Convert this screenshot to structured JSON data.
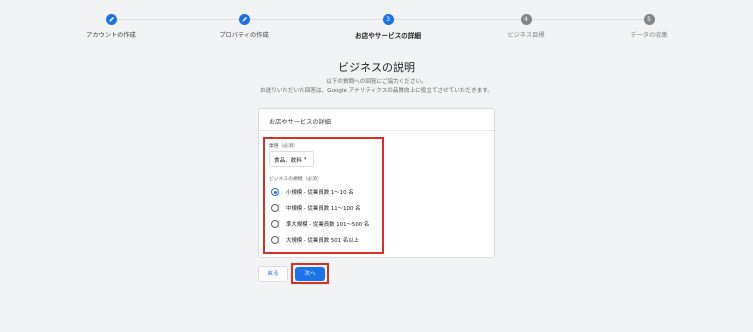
{
  "stepper": {
    "steps": [
      {
        "label": "アカウントの作成",
        "marker": "",
        "icon": "pencil-icon",
        "state": "done"
      },
      {
        "label": "プロパティの作成",
        "marker": "",
        "icon": "pencil-icon",
        "state": "done"
      },
      {
        "label": "お店やサービスの詳細",
        "marker": "3",
        "state": "active"
      },
      {
        "label": "ビジネス目標",
        "marker": "4",
        "state": "todo"
      },
      {
        "label": "データの収集",
        "marker": "5",
        "state": "todo"
      }
    ]
  },
  "page": {
    "title": "ビジネスの説明",
    "subtitle_line1": "以下の質問への回答にご協力ください。",
    "subtitle_line2": "お送りいただいた回答は、Google アナリティクスの品質向上に役立てさせていただきます。"
  },
  "card": {
    "header": "お店やサービスの詳細",
    "industry_label": "業種（必須）",
    "industry_value": "食品、飲料",
    "industry_caret": "▾",
    "size_label": "ビジネスの規模（必須）",
    "sizes": [
      {
        "label": "小規模 - 従業員数 1〜10 名",
        "checked": true
      },
      {
        "label": "中規模 - 従業員数 11〜100 名",
        "checked": false
      },
      {
        "label": "準大規模 - 従業員数 101〜500 名",
        "checked": false
      },
      {
        "label": "大規模 - 従業員数 501 名以上",
        "checked": false
      }
    ]
  },
  "actions": {
    "back_label": "戻る",
    "next_label": "次へ"
  },
  "colors": {
    "accent": "#1a73e8",
    "highlight": "#d93025"
  }
}
